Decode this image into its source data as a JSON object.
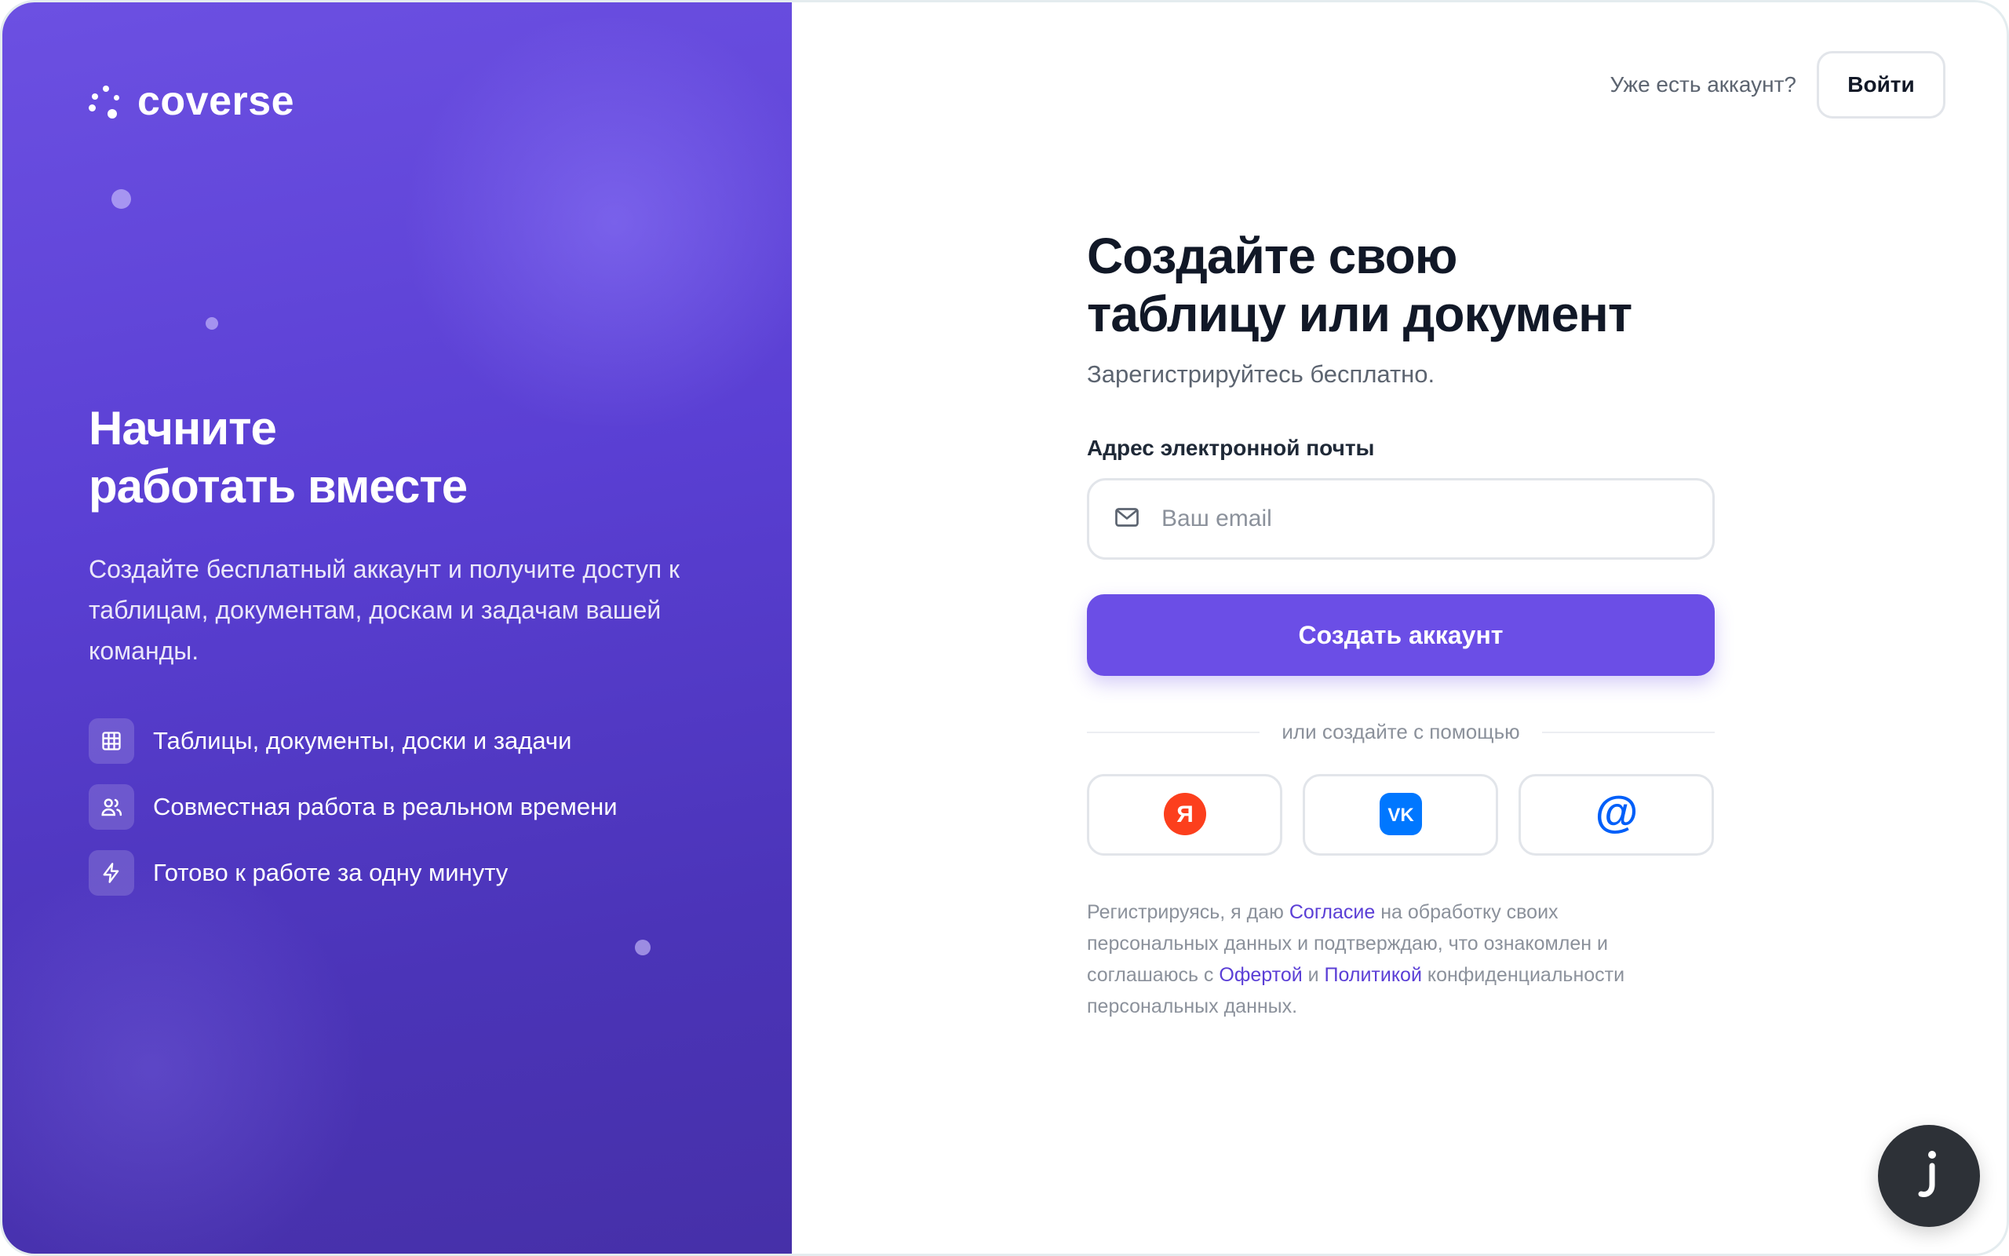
{
  "brand": {
    "name": "coverse"
  },
  "left": {
    "title_line1": "Начните",
    "title_line2": "работать вместе",
    "description": "Создайте бесплатный аккаунт и получите доступ к таблицам, документам, доскам и задачам вашей команды.",
    "features": [
      {
        "icon": "table-icon",
        "label": "Таблицы, документы, доски и задачи"
      },
      {
        "icon": "users-icon",
        "label": "Совместная работа в реальном времени"
      },
      {
        "icon": "lightning-icon",
        "label": "Готово к работе за одну минуту"
      }
    ]
  },
  "header": {
    "have_account": "Уже есть аккаунт?",
    "login_label": "Войти"
  },
  "form": {
    "heading_line1": "Создайте свою",
    "heading_line2": "таблицу или документ",
    "subtitle": "Зарегистрируйтесь бесплатно.",
    "email_label": "Адрес электронной почты",
    "email_placeholder": "Ваш email",
    "email_value": "",
    "submit_label": "Создать аккаунт",
    "divider_text": "или создайте с помощью",
    "socials": [
      {
        "icon": "yandex-icon",
        "glyph": "Я",
        "color": "#fc3f1d"
      },
      {
        "icon": "vk-icon",
        "glyph": "VK",
        "color": "#0077ff"
      },
      {
        "icon": "mail-ru-icon",
        "glyph": "@",
        "color": "#005ff9"
      }
    ]
  },
  "legal": {
    "t1": "Регистрируясь, я даю ",
    "link_consent": "Согласие",
    "t2": " на обработку своих персональных данных и подтверждаю, что ознакомлен и соглашаюсь с ",
    "link_offer": "Офертой",
    "t3": " и ",
    "link_policy": "Политикой",
    "t4": " конфиденциальности персональных данных."
  },
  "colors": {
    "accent": "#6b4ee6",
    "panel": "#5a3fd3",
    "link": "#5b3fd6"
  },
  "chat": {
    "icon": "chat-widget-icon"
  }
}
